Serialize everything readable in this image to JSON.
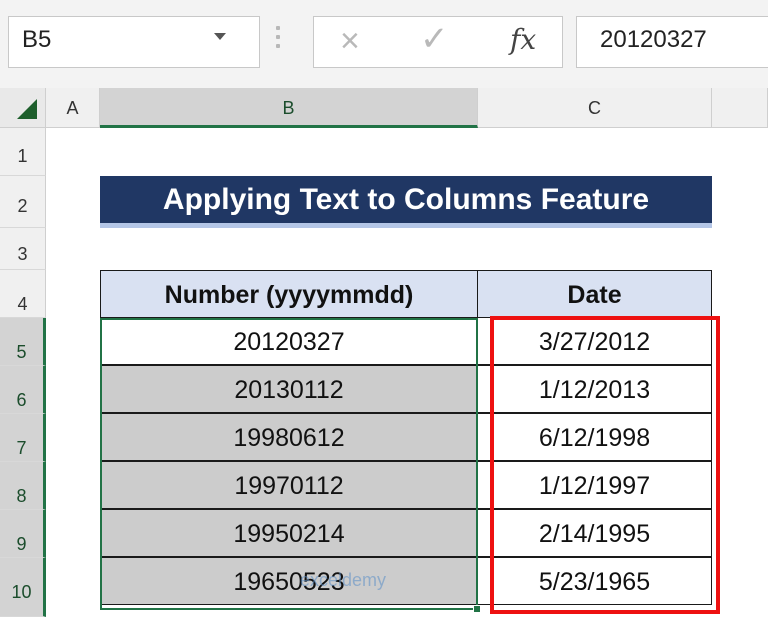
{
  "formula_bar": {
    "name_box": "B5",
    "cancel_icon": "×",
    "enter_icon": "✓",
    "fx_label": "fx",
    "formula_value": "20120327"
  },
  "columns": [
    "A",
    "B",
    "C"
  ],
  "rows": [
    "1",
    "2",
    "3",
    "4",
    "5",
    "6",
    "7",
    "8",
    "9",
    "10"
  ],
  "title": "Applying Text to Columns Feature",
  "table": {
    "headers": [
      "Number (yyyymmdd)",
      "Date"
    ],
    "rows": [
      [
        "20120327",
        "3/27/2012"
      ],
      [
        "20130112",
        "1/12/2013"
      ],
      [
        "19980612",
        "6/12/1998"
      ],
      [
        "19970112",
        "1/12/1997"
      ],
      [
        "19950214",
        "2/14/1995"
      ],
      [
        "19650523",
        "5/23/1965"
      ]
    ]
  },
  "watermark": "exceldemy",
  "colors": {
    "title_bg": "#203764",
    "header_bg": "#d9e1f2",
    "selection": "#217346",
    "highlight": "#ee1111"
  }
}
